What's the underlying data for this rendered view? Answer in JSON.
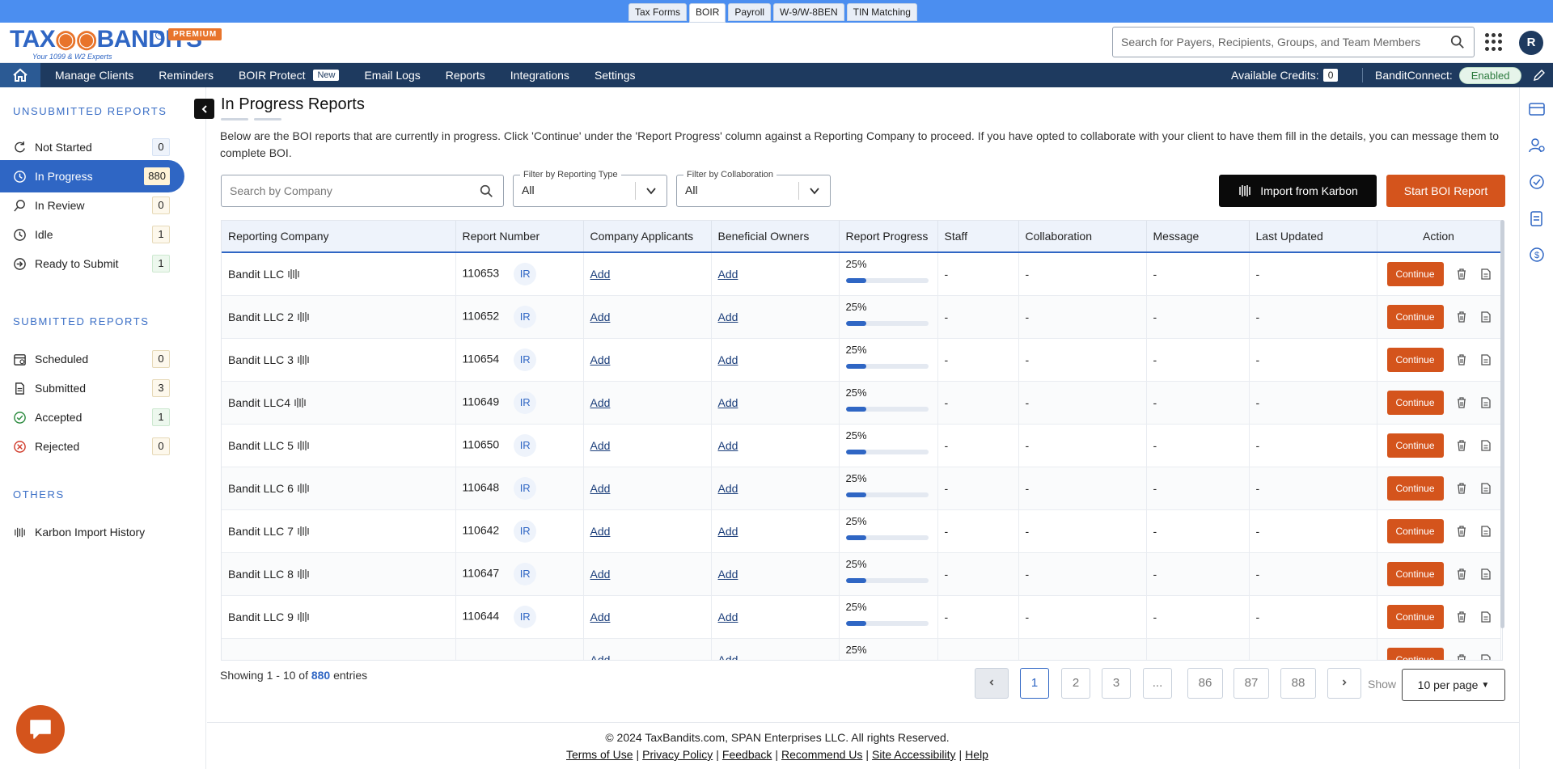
{
  "product_tabs": [
    "Tax Forms",
    "BOIR",
    "Payroll",
    "W-9/W-8BEN",
    "TIN Matching"
  ],
  "product_tab_active": "BOIR",
  "brand": {
    "logo_text_a": "TAX",
    "logo_text_b": "BANDITS",
    "tagline": "Your 1099 & W2 Experts",
    "premium": "PREMIUM",
    "tm": "TM"
  },
  "header": {
    "search_placeholder": "Search for Payers, Recipients, Groups, and Team Members",
    "avatar_letter": "R"
  },
  "nav": {
    "items": [
      "Manage Clients",
      "Reminders",
      "BOIR Protect",
      "Email Logs",
      "Reports",
      "Integrations",
      "Settings"
    ],
    "new_badge": "New",
    "credits_label": "Available Credits:",
    "credits_value": "0",
    "banditconnect_label": "BanditConnect:",
    "banditconnect_status": "Enabled"
  },
  "sidebar": {
    "unsubmitted_title": "UNSUBMITTED REPORTS",
    "unsubmitted": [
      {
        "label": "Not Started",
        "count": "0",
        "icon": "refresh-icon"
      },
      {
        "label": "In Progress",
        "count": "880",
        "icon": "clock-icon"
      },
      {
        "label": "In Review",
        "count": "0",
        "icon": "search-icon"
      },
      {
        "label": "Idle",
        "count": "1",
        "icon": "clock-icon"
      },
      {
        "label": "Ready to Submit",
        "count": "1",
        "icon": "arrow-circle-icon"
      }
    ],
    "submitted_title": "SUBMITTED REPORTS",
    "submitted": [
      {
        "label": "Scheduled",
        "count": "0",
        "icon": "calendar-icon"
      },
      {
        "label": "Submitted",
        "count": "3",
        "icon": "document-icon"
      },
      {
        "label": "Accepted",
        "count": "1",
        "icon": "check-circle-icon"
      },
      {
        "label": "Rejected",
        "count": "0",
        "icon": "x-circle-icon"
      }
    ],
    "others_title": "OTHERS",
    "others": [
      {
        "label": "Karbon Import History",
        "icon": "karbon-icon"
      }
    ]
  },
  "main": {
    "title": "In Progress Reports",
    "description": "Below are the BOI reports that are currently in progress. Click 'Continue' under the 'Report Progress' column against a Reporting Company to proceed. If you have opted to collaborate with your client to have them fill in the details, you can message them to complete BOI.",
    "company_search_placeholder": "Search by Company",
    "filter_type_label": "Filter by Reporting Type",
    "filter_type_value": "All",
    "filter_collab_label": "Filter by Collaboration",
    "filter_collab_value": "All",
    "import_button": "Import from Karbon",
    "start_button": "Start BOI Report"
  },
  "table": {
    "columns": [
      "Reporting Company",
      "Report Number",
      "Company Applicants",
      "Beneficial Owners",
      "Report Progress",
      "Staff",
      "Collaboration",
      "Message",
      "Last Updated",
      "Action"
    ],
    "add_label": "Add",
    "continue_label": "Continue",
    "dash": "-",
    "rows": [
      {
        "company": "Bandit LLC",
        "number": "110653",
        "type": "IR",
        "progress_text": "25%",
        "progress": 0.25
      },
      {
        "company": "Bandit LLC 2",
        "number": "110652",
        "type": "IR",
        "progress_text": "25%",
        "progress": 0.25
      },
      {
        "company": "Bandit LLC 3",
        "number": "110654",
        "type": "IR",
        "progress_text": "25%",
        "progress": 0.25
      },
      {
        "company": "Bandit LLC4",
        "number": "110649",
        "type": "IR",
        "progress_text": "25%",
        "progress": 0.25
      },
      {
        "company": "Bandit LLC 5",
        "number": "110650",
        "type": "IR",
        "progress_text": "25%",
        "progress": 0.25
      },
      {
        "company": "Bandit LLC 6",
        "number": "110648",
        "type": "IR",
        "progress_text": "25%",
        "progress": 0.25
      },
      {
        "company": "Bandit LLC 7",
        "number": "110642",
        "type": "IR",
        "progress_text": "25%",
        "progress": 0.25
      },
      {
        "company": "Bandit LLC 8",
        "number": "110647",
        "type": "IR",
        "progress_text": "25%",
        "progress": 0.25
      },
      {
        "company": "Bandit LLC 9",
        "number": "110644",
        "type": "IR",
        "progress_text": "25%",
        "progress": 0.25
      },
      {
        "company": "",
        "number": "",
        "type": "",
        "progress_text": "25%",
        "progress": 0.25
      }
    ]
  },
  "pagination": {
    "showing_prefix": "Showing 1 - 10 of",
    "total": "880",
    "showing_suffix": "entries",
    "pages": [
      "1",
      "2",
      "3",
      "...",
      "86",
      "87",
      "88"
    ],
    "active_page": "1",
    "show_label": "Show",
    "per_page": "10 per page"
  },
  "footer": {
    "copyright": "© 2024 TaxBandits.com, SPAN Enterprises LLC. All rights Reserved.",
    "links": [
      "Terms of Use",
      "Privacy Policy",
      "Feedback",
      "Recommend Us",
      "Site Accessibility",
      "Help"
    ]
  },
  "colors": {
    "primary": "#2f66c4",
    "navy": "#1e3a5f",
    "accent_orange": "#d4541c",
    "topstrip": "#4b8ef0"
  }
}
